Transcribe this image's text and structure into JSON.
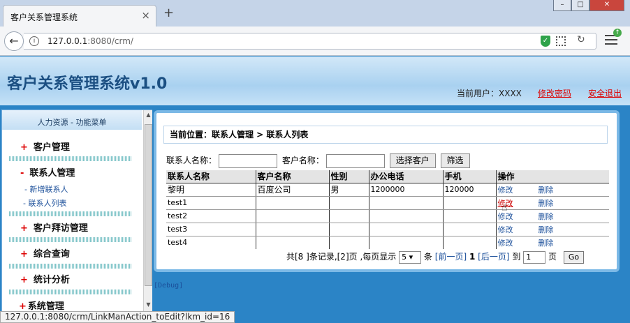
{
  "browser": {
    "tab_title": "客户关系管理系统",
    "close_glyph": "×",
    "newtab_glyph": "+",
    "url_host": "127.0.0.1",
    "url_rest": ":8080/crm/",
    "status_url": "127.0.0.1:8080/crm/LinkManAction_toEdit?lkm_id=16"
  },
  "header": {
    "title": "客户关系管理系统v1.0",
    "current_user": "当前用户：XXXX",
    "change_password": "修改密码",
    "logout": "安全退出"
  },
  "sidebar": {
    "heading": "人力资源 - 功能菜单",
    "items": [
      {
        "symbol": "+",
        "label": "客户管理"
      },
      {
        "symbol": "-",
        "label": "联系人管理"
      },
      {
        "symbol": "+",
        "label": "客户拜访管理"
      },
      {
        "symbol": "+",
        "label": "综合查询"
      },
      {
        "symbol": "+",
        "label": "统计分析"
      },
      {
        "symbol": "+",
        "label": "系统管理"
      }
    ],
    "subitems": [
      "- 新增联系人",
      "- 联系人列表"
    ]
  },
  "main": {
    "location": "当前位置：联系人管理 > 联系人列表",
    "search": {
      "contact_label": "联系人名称：",
      "customer_label": "客户名称：",
      "select_customer_button": "选择客户",
      "filter_button": "筛选"
    },
    "table": {
      "headers": [
        "联系人名称",
        "客户名称",
        "性别",
        "办公电话",
        "手机",
        "操作"
      ],
      "rows": [
        {
          "name": "黎明",
          "customer": "百度公司",
          "gender": "男",
          "office": "1200000",
          "mobile": "120000",
          "edit": "修改",
          "delete": "删除"
        },
        {
          "name": "test1",
          "customer": "",
          "gender": "",
          "office": "",
          "mobile": "",
          "edit": "修改",
          "delete": "删除"
        },
        {
          "name": "test2",
          "customer": "",
          "gender": "",
          "office": "",
          "mobile": "",
          "edit": "修改",
          "delete": "删除"
        },
        {
          "name": "test3",
          "customer": "",
          "gender": "",
          "office": "",
          "mobile": "",
          "edit": "修改",
          "delete": "删除"
        },
        {
          "name": "test4",
          "customer": "",
          "gender": "",
          "office": "",
          "mobile": "",
          "edit": "修改",
          "delete": "删除"
        }
      ]
    },
    "pager": {
      "summary": "共[8 ]条记录,[2]页 ,每页显示",
      "page_size": "5",
      "unit": "条",
      "prev": "[前一页]",
      "current": "1",
      "next": "[后一页]",
      "goto_label": "到",
      "goto_value": "1",
      "page_unit": "页",
      "go_button": "Go"
    },
    "debug": "[Debug]"
  }
}
